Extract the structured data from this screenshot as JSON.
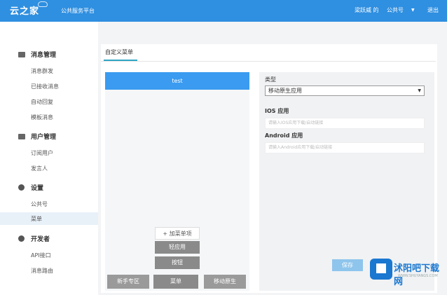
{
  "header": {
    "logo": "云之家",
    "platform": "公共服务平台",
    "user": "梁跃威",
    "user_suffix": "的",
    "account": "公共号",
    "account_caret": "▼",
    "logout": "退出"
  },
  "sidebar": {
    "sections": [
      {
        "title": "消息管理",
        "icon": "message-icon",
        "items": [
          "消息群发",
          "已接收消息",
          "自动回复",
          "模板消息"
        ]
      },
      {
        "title": "用户管理",
        "icon": "user-icon",
        "items": [
          "订阅用户",
          "发言人"
        ]
      },
      {
        "title": "设置",
        "icon": "gear-icon",
        "items": [
          "公共号",
          "菜单"
        ]
      },
      {
        "title": "开发者",
        "icon": "developer-icon",
        "items": [
          "API接口",
          "消息路由"
        ]
      }
    ],
    "active_item": "菜单"
  },
  "page": {
    "tab": "自定义菜单"
  },
  "preview": {
    "top_item": "test",
    "submenu_add": "加菜单项",
    "submenu_items": [
      "轻应用",
      "按钮"
    ],
    "bottom_menu": [
      "新手专区",
      "菜单",
      "移动原生"
    ]
  },
  "editor": {
    "type_label": "类型",
    "type_value": "移动原生应用",
    "ios_label": "IOS 应用",
    "ios_placeholder": "请输入IOS应用下载/启动链接",
    "android_label": "Android 应用",
    "android_placeholder": "请输入Android应用下载/启动链接",
    "save_button": "保存"
  },
  "watermark": {
    "text": "沭阳吧下载网",
    "url": "WWW.SHUYANGS.COM"
  }
}
